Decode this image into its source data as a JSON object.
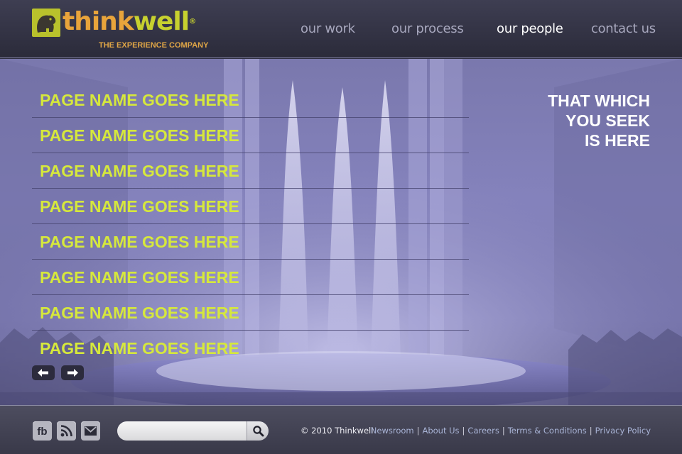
{
  "brand": {
    "name_part_a": "think",
    "name_part_b": "well",
    "trademark": "®",
    "tagline": "THE EXPERIENCE COMPANY",
    "colors": {
      "orange": "#e8a43b",
      "green": "#c7d12f",
      "accent_text": "#d6e83c"
    }
  },
  "nav": {
    "items": [
      {
        "label": "our work",
        "active": false
      },
      {
        "label": "our process",
        "active": false
      },
      {
        "label": "our people",
        "active": true
      },
      {
        "label": "contact us",
        "active": false
      }
    ]
  },
  "hero": {
    "page_items": [
      "PAGE NAME GOES HERE",
      "PAGE NAME GOES HERE",
      "PAGE NAME GOES HERE",
      "PAGE NAME GOES HERE",
      "PAGE NAME GOES HERE",
      "PAGE NAME GOES HERE",
      "PAGE NAME GOES HERE",
      "PAGE NAME GOES HERE"
    ],
    "tagline_lines": [
      "THAT WHICH",
      "YOU SEEK",
      "IS HERE"
    ],
    "prev_icon": "arrow-left-icon",
    "next_icon": "arrow-right-icon"
  },
  "footer": {
    "social": [
      {
        "icon": "facebook-icon",
        "label": "fb"
      },
      {
        "icon": "rss-icon"
      },
      {
        "icon": "mail-icon"
      }
    ],
    "search": {
      "value": "",
      "placeholder": "",
      "icon": "search-icon"
    },
    "copyright": "© 2010 Thinkwell",
    "links": [
      "Newsroom",
      "About Us",
      "Careers",
      "Terms & Conditions",
      "Privacy Policy"
    ],
    "separator": "|"
  }
}
